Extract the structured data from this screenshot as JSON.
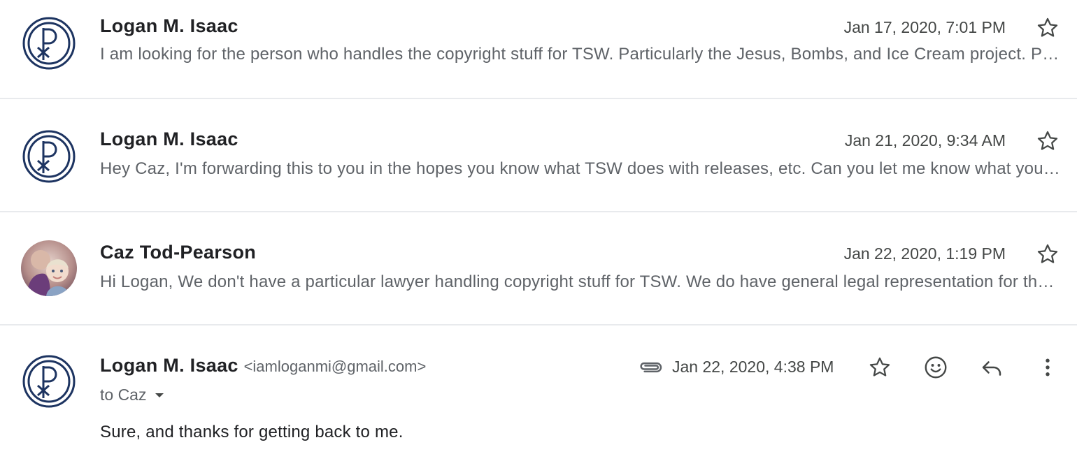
{
  "messages": [
    {
      "sender": "Logan M. Isaac",
      "date": "Jan 17, 2020, 7:01 PM",
      "snippet": "I am looking for the person who handles the copyright stuff for TSW. Particularly the Jesus, Bombs, and Ice Cream project. Please let me know who I should talk to.",
      "avatar": "chi-rho-logo",
      "starred": false
    },
    {
      "sender": "Logan M. Isaac",
      "date": "Jan 21, 2020, 9:34 AM",
      "snippet": "Hey Caz, I'm forwarding this to you in the hopes you know what TSW does with releases, etc. Can you let me know what you think?",
      "avatar": "chi-rho-logo",
      "starred": false
    },
    {
      "sender": "Caz Tod-Pearson",
      "date": "Jan 22, 2020, 1:19 PM",
      "snippet": "Hi Logan, We don't have a particular lawyer handling copyright stuff for TSW. We do have general legal representation for the organization.",
      "avatar": "photo-two-children",
      "starred": false
    }
  ],
  "open_message": {
    "sender": "Logan M. Isaac",
    "email": "<iamloganmi@gmail.com>",
    "date": "Jan 22, 2020, 4:38 PM",
    "recipient": "to Caz",
    "body": "Sure, and thanks for getting back to me.",
    "has_attachment": true,
    "avatar": "chi-rho-logo",
    "starred": false
  },
  "icons": {
    "star": "star-outline-icon",
    "emoji": "emoji-reaction-icon",
    "reply": "reply-icon",
    "more": "more-vertical-icon",
    "attachment": "paperclip-icon",
    "recipient_dropdown": "caret-down-icon"
  },
  "colors": {
    "logo_navy": "#1d3461",
    "text_primary": "#202124",
    "text_secondary": "#5f6368",
    "divider": "#e8eaed",
    "icon": "#444746"
  }
}
